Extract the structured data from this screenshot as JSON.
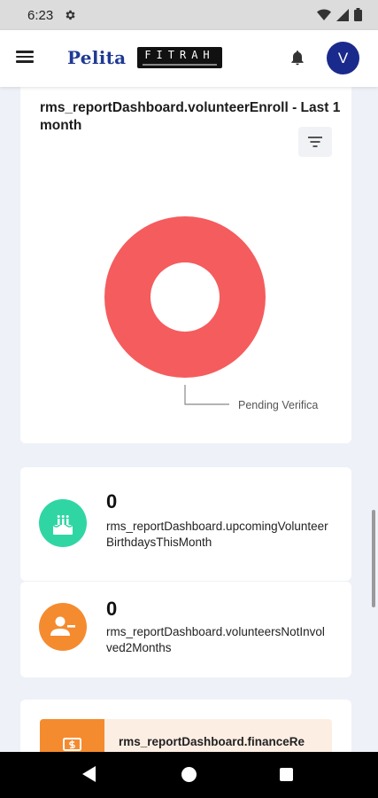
{
  "status_bar": {
    "time": "6:23"
  },
  "app_bar": {
    "logo_pelita": "Pelita",
    "logo_fitrah": "FITRAH",
    "avatar_initial": "V"
  },
  "enroll_chart": {
    "title": "rms_reportDashboard.volunteerEnroll - Last 1 month",
    "filter_icon": "filter-icon",
    "chart_data": {
      "type": "pie",
      "style": "donut",
      "slices": [
        {
          "label": "Pending Verifica",
          "value": 1,
          "color": "#f55c5e"
        }
      ]
    }
  },
  "birthdays_stat": {
    "value": "0",
    "label": "rms_reportDashboard.upcomingVolunteerBirthdaysThisMonth",
    "icon": "cake-icon",
    "color": "#2fd6a3"
  },
  "not_involved_stat": {
    "value": "0",
    "label": "rms_reportDashboard.volunteersNotInvolved2Months",
    "icon": "user-remove-icon",
    "color": "#f58b2f"
  },
  "finance_card": {
    "label": "rms_reportDashboard.financeRe",
    "icon": "finance-icon",
    "color": "#f58b2f"
  }
}
